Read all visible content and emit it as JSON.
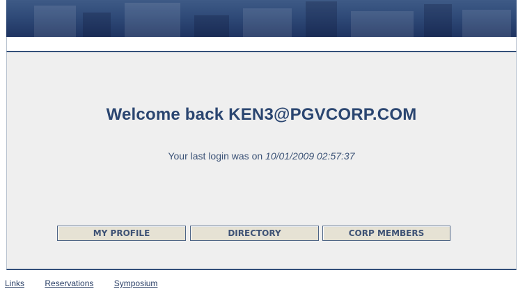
{
  "welcome": {
    "prefix": "Welcome back",
    "email": "KEN3@PGVCORP.COM"
  },
  "last_login": {
    "label": "Your last login was on",
    "timestamp": "10/01/2009 02:57:37"
  },
  "buttons": [
    {
      "label": "MY PROFILE"
    },
    {
      "label": "DIRECTORY"
    },
    {
      "label": "CORP MEMBERS"
    }
  ],
  "footer_links": [
    {
      "label": "Links"
    },
    {
      "label": "Reservations"
    },
    {
      "label": "Symposium"
    }
  ],
  "colors": {
    "banner": "#2f4a78",
    "heading": "#2a4570",
    "content_bg": "#efefef",
    "button_bg": "#e6e2d4",
    "border": "#33507a"
  }
}
